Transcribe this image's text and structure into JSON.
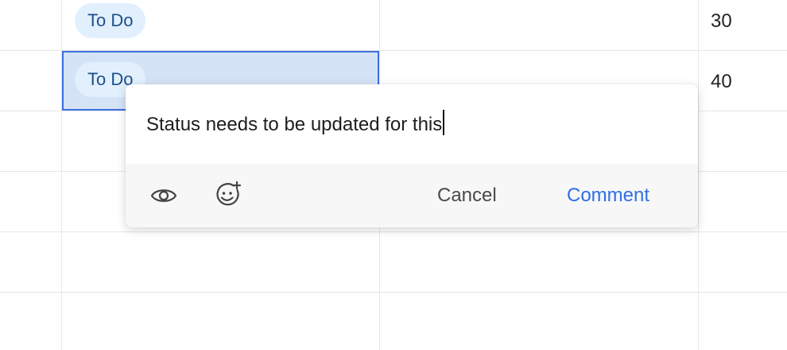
{
  "table": {
    "rows": [
      {
        "status": "To Do",
        "number": "30",
        "selected": false
      },
      {
        "status": "To Do",
        "number": "40",
        "selected": true
      }
    ]
  },
  "comment_popover": {
    "input_value": "Status needs to be updated for this",
    "icons": {
      "watch": "eye-icon",
      "emoji": "add-emoji-icon"
    },
    "cancel_label": "Cancel",
    "comment_label": "Comment"
  },
  "colors": {
    "accent": "#2f6fe4",
    "selection_fill": "#d5e3f7",
    "selection_border": "#3b6fe0",
    "status_pill_bg": "#e1f0fc",
    "status_pill_text": "#1f4f8a"
  }
}
